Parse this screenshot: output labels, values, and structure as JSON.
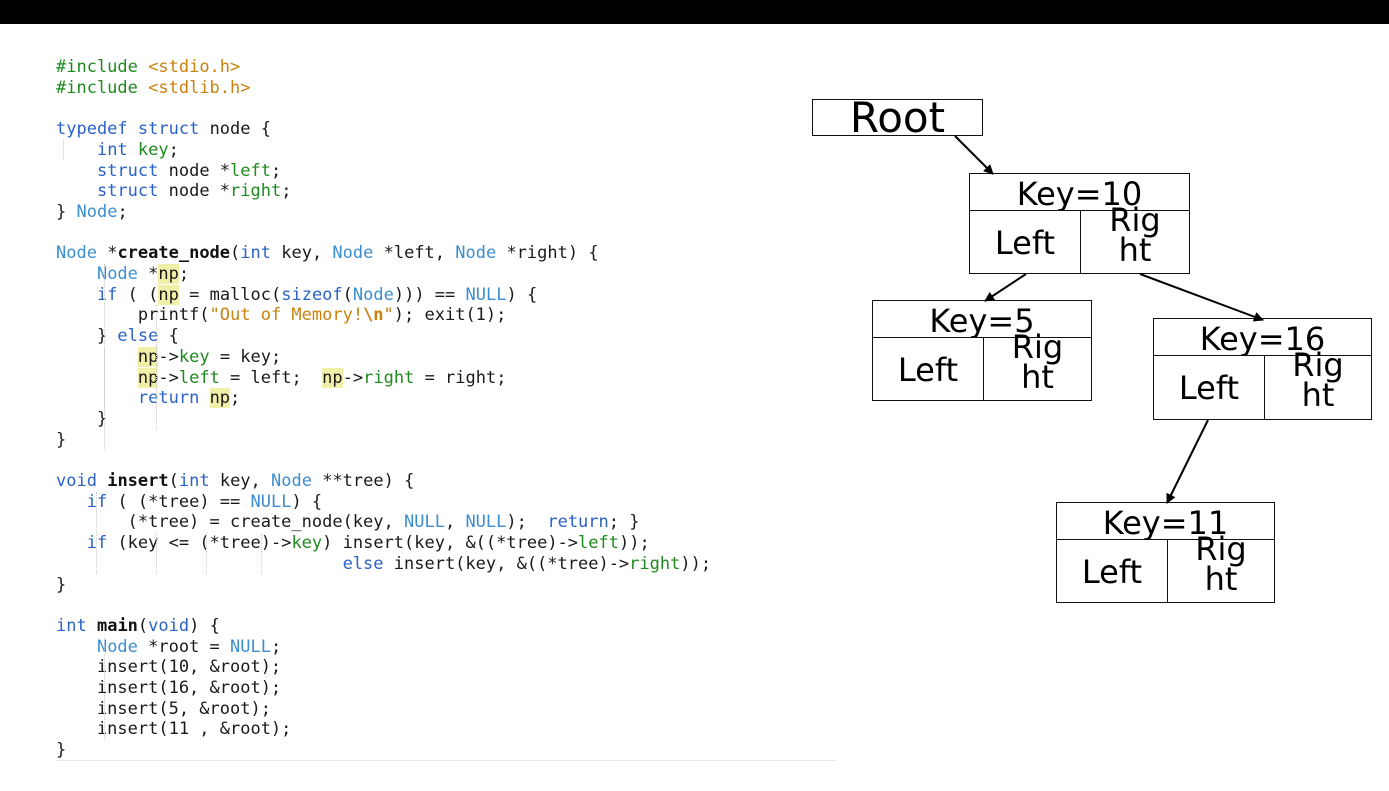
{
  "code": {
    "lines": [
      "#include <stdio.h>",
      "#include <stdlib.h>",
      "",
      "typedef struct node {",
      "    int key;",
      "    struct node *left;",
      "    struct node *right;",
      "} Node;",
      "",
      "Node *create_node(int key, Node *left, Node *right) {",
      "    Node *np;",
      "    if ( (np = malloc(sizeof(Node))) == NULL) {",
      "        printf(\"Out of Memory!\\n\"); exit(1);",
      "    } else {",
      "        np->key = key;",
      "        np->left = left;  np->right = right;",
      "        return np;",
      "    }",
      "}",
      "",
      "void insert(int key, Node **tree) {",
      "   if ( (*tree) == NULL) {",
      "       (*tree) = create_node(key, NULL, NULL);  return; }",
      "   if (key <= (*tree)->key) insert(key, &((*tree)->left));",
      "                            else insert(key, &((*tree)->right));",
      "}",
      "",
      "int main(void) {",
      "    Node *root = NULL;",
      "    insert(10, &root);",
      "    insert(16, &root);",
      "    insert(5, &root);",
      "    insert(11 , &root);",
      "}"
    ]
  },
  "diagram": {
    "root_label": "Root",
    "nodes": [
      {
        "key": "Key=10",
        "left": "Left",
        "right": "Rig ht"
      },
      {
        "key": "Key=5",
        "left": "Left",
        "right": "Rig ht"
      },
      {
        "key": "Key=16",
        "left": "Left",
        "right": "Rig ht"
      },
      {
        "key": "Key=11",
        "left": "Left",
        "right": "Rig ht"
      }
    ]
  }
}
